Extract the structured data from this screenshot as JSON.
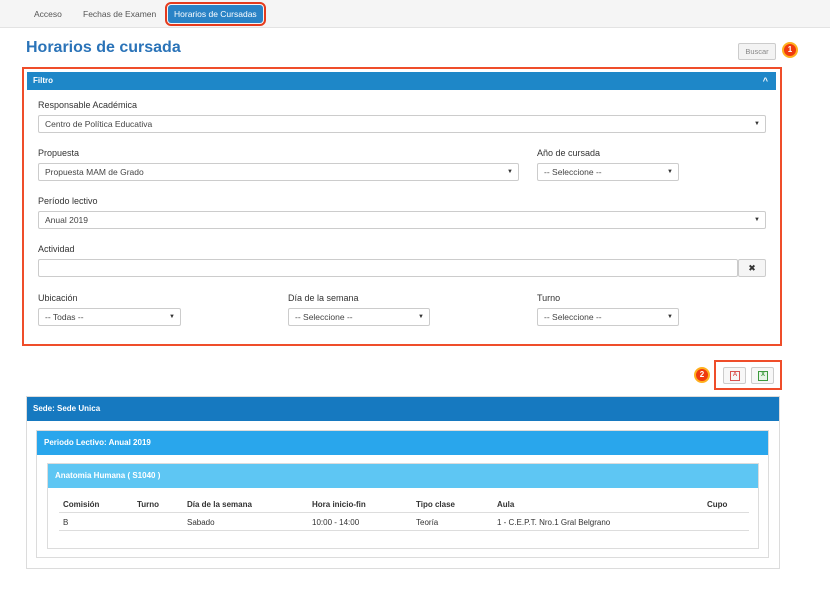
{
  "nav": {
    "tabs": [
      {
        "label": "Acceso",
        "active": false
      },
      {
        "label": "Fechas de Examen",
        "active": false
      },
      {
        "label": "Horarios de Cursadas",
        "active": true
      }
    ]
  },
  "page": {
    "title": "Horarios de cursada",
    "search_button": "Buscar"
  },
  "markers": [
    "1",
    "2"
  ],
  "filter": {
    "header": "Filtro",
    "collapse_icon": "chevron-up-icon",
    "responsable": {
      "label": "Responsable Académica",
      "value": "Centro de Política Educativa"
    },
    "propuesta": {
      "label": "Propuesta",
      "value": "Propuesta MAM de Grado"
    },
    "anio": {
      "label": "Año de cursada",
      "value": "-- Seleccione --"
    },
    "periodo": {
      "label": "Período lectivo",
      "value": "Anual 2019"
    },
    "actividad": {
      "label": "Actividad",
      "value": "",
      "clear_icon": "✖"
    },
    "ubicacion": {
      "label": "Ubicación",
      "value": "-- Todas --"
    },
    "dia": {
      "label": "Día de la semana",
      "value": "-- Seleccione --"
    },
    "turno": {
      "label": "Turno",
      "value": "-- Seleccione --"
    },
    "dropdown_arrow": "▼"
  },
  "export": {
    "pdf_icon": "pdf-icon",
    "excel_icon": "excel-icon",
    "pdf_color": "#d9534f",
    "excel_color": "#3c9a3c"
  },
  "results": {
    "sede": "Sede: Sede Unica",
    "periodo": "Periodo Lectivo: Anual 2019",
    "actividad": "Anatomia Humana ( S1040 )",
    "columns": [
      "Comisión",
      "Turno",
      "Día de la semana",
      "Hora inicio-fin",
      "Tipo clase",
      "Aula",
      "Cupo"
    ],
    "rows": [
      [
        "B",
        "",
        "Sabado",
        "10:00 - 14:00",
        "Teoría",
        "1 - C.E.P.T. Nro.1 Gral Belgrano",
        ""
      ]
    ]
  },
  "colors": {
    "accent": "#2a83c6",
    "highlight": "#ef4d2a",
    "sede_header": "#1679c0",
    "periodo_header": "#29a6ec",
    "activity_header": "#5ec6f3"
  }
}
